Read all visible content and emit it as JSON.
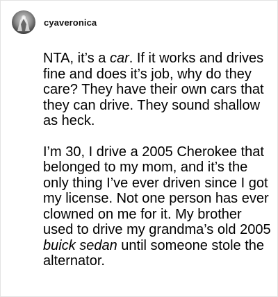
{
  "post": {
    "author": {
      "username": "cyaveronica",
      "avatar_icon": "avatar-icon"
    },
    "paragraphs": [
      [
        {
          "text": "NTA, it’s a ",
          "italic": false
        },
        {
          "text": "car",
          "italic": true
        },
        {
          "text": ". If it works and drives fine and does it’s job, why do they care? They have their own cars that they can drive. They sound shallow as heck.",
          "italic": false
        }
      ],
      [
        {
          "text": "I’m 30, I drive a 2005 Cherokee that belonged to my mom, and it’s the only thing I’ve ever driven since I got my license. Not one person has ever clowned on me for it. My brother used to drive my grandma’s old 2005 ",
          "italic": false
        },
        {
          "text": "buick sedan",
          "italic": true
        },
        {
          "text": " until someone stole the alternator.",
          "italic": false
        }
      ]
    ]
  },
  "colors": {
    "border": "#e3e3e3",
    "text": "#000000",
    "background": "#ffffff"
  }
}
